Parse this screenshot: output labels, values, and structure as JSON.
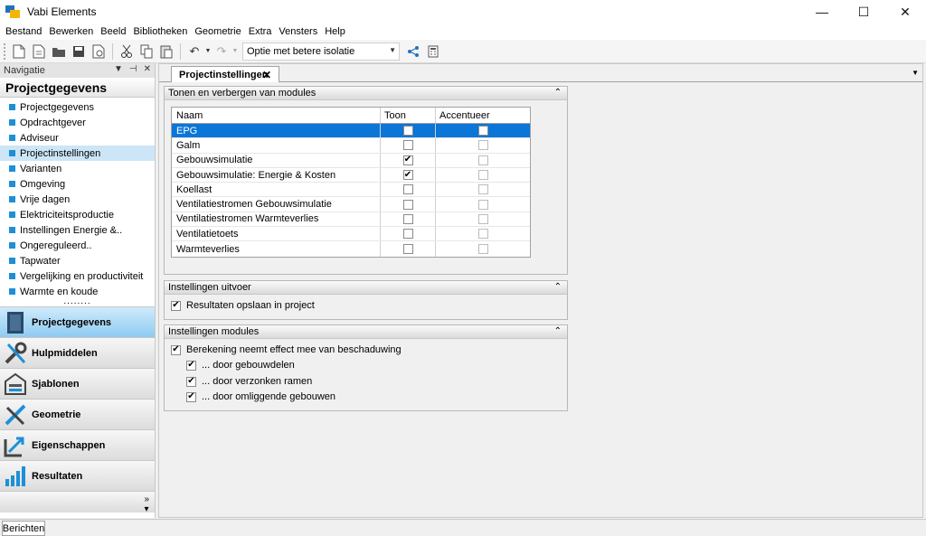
{
  "window": {
    "title": "Vabi Elements",
    "minimize": "—",
    "maximize": "☐",
    "close": "✕"
  },
  "menu": [
    "Bestand",
    "Bewerken",
    "Beeld",
    "Bibliotheken",
    "Geometrie",
    "Extra",
    "Vensters",
    "Help"
  ],
  "toolbar": {
    "variant_select": "Optie met betere isolatie"
  },
  "navigation": {
    "panel_title": "Navigatie",
    "section_title": "Projectgegevens",
    "items": [
      "Projectgegevens",
      "Opdrachtgever",
      "Adviseur",
      "Projectinstellingen",
      "Varianten",
      "Omgeving",
      "Vrije dagen",
      "Elektriciteitsproductie",
      "Instellingen Energie &..",
      "Ongereguleerd..",
      "Tapwater",
      "Vergelijking en productiviteit",
      "Warmte en koude"
    ],
    "selected_index": 3,
    "sections": [
      "Projectgegevens",
      "Hulpmiddelen",
      "Sjablonen",
      "Geometrie",
      "Eigenschappen",
      "Resultaten"
    ],
    "active_section_index": 0
  },
  "tab": {
    "label": "Projectinstellingen",
    "close": "✕"
  },
  "modules_group": {
    "title": "Tonen en verbergen van modules",
    "columns": [
      "Naam",
      "Toon",
      "Accentueer"
    ],
    "rows": [
      {
        "name": "EPG",
        "show": false,
        "accent": false
      },
      {
        "name": "Galm",
        "show": false,
        "accent": false
      },
      {
        "name": "Gebouwsimulatie",
        "show": true,
        "accent": false
      },
      {
        "name": "Gebouwsimulatie: Energie &  Kosten",
        "show": true,
        "accent": false
      },
      {
        "name": "Koellast",
        "show": false,
        "accent": false
      },
      {
        "name": "Ventilatiestromen Gebouwsimulatie",
        "show": false,
        "accent": false
      },
      {
        "name": "Ventilatiestromen Warmteverlies",
        "show": false,
        "accent": false
      },
      {
        "name": "Ventilatietoets",
        "show": false,
        "accent": false
      },
      {
        "name": "Warmteverlies",
        "show": false,
        "accent": false
      }
    ],
    "selected_row": 0
  },
  "output_group": {
    "title": "Instellingen uitvoer",
    "options": [
      {
        "label": "Resultaten opslaan in project",
        "checked": true
      }
    ]
  },
  "modules_settings_group": {
    "title": "Instellingen modules",
    "options": [
      {
        "label": "Berekening neemt effect mee van beschaduwing",
        "checked": true,
        "indent": 0
      },
      {
        "label": "... door gebouwdelen",
        "checked": true,
        "indent": 1
      },
      {
        "label": "... door verzonken ramen",
        "checked": true,
        "indent": 1
      },
      {
        "label": "... door omliggende gebouwen",
        "checked": true,
        "indent": 1
      }
    ]
  },
  "statusbar": {
    "tab": "Berichten"
  },
  "colors": {
    "accent": "#0a76d8",
    "nav_square": "#1e8fd6",
    "active_section": "#8ecbf2"
  }
}
